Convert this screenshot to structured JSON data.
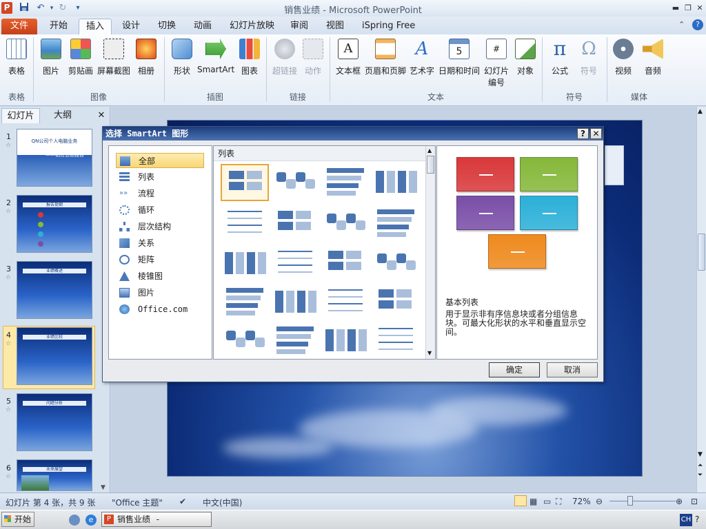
{
  "window": {
    "title": "销售业绩 - Microsoft PowerPoint",
    "app_icon_letter": "P"
  },
  "tabs": [
    {
      "label": "文件"
    },
    {
      "label": "开始"
    },
    {
      "label": "插入"
    },
    {
      "label": "设计"
    },
    {
      "label": "切换"
    },
    {
      "label": "动画"
    },
    {
      "label": "幻灯片放映"
    },
    {
      "label": "审阅"
    },
    {
      "label": "视图"
    },
    {
      "label": "iSpring Free"
    }
  ],
  "ribbon": {
    "buttons": [
      {
        "label": "表格"
      },
      {
        "label": "图片"
      },
      {
        "label": "剪贴画"
      },
      {
        "label": "屏幕截图"
      },
      {
        "label": "相册"
      },
      {
        "label": "形状"
      },
      {
        "label": "SmartArt"
      },
      {
        "label": "图表"
      },
      {
        "label": "超链接"
      },
      {
        "label": "动作"
      },
      {
        "label": "文本框"
      },
      {
        "label": "页眉和页脚"
      },
      {
        "label": "艺术字"
      },
      {
        "label": "日期和时间"
      },
      {
        "label": "幻灯片"
      },
      {
        "label": "对象"
      },
      {
        "label": "公式"
      },
      {
        "label": "符号"
      },
      {
        "label": "视频"
      },
      {
        "label": "音频"
      }
    ],
    "slide_number_second_line": "编号",
    "groups": [
      {
        "label": "表格"
      },
      {
        "label": "图像"
      },
      {
        "label": "插图"
      },
      {
        "label": "链接"
      },
      {
        "label": "文本"
      },
      {
        "label": "符号"
      },
      {
        "label": "媒体"
      }
    ]
  },
  "left_panel": {
    "tab_slides": "幻灯片",
    "tab_outline": "大纲",
    "close": "✕",
    "slides": [
      {
        "num": "1",
        "title": "QN公司个人电脑业务",
        "subtitle": "——销售业绩报告"
      },
      {
        "num": "2",
        "title": "报告提纲"
      },
      {
        "num": "3",
        "title": "业绩概述"
      },
      {
        "num": "4",
        "title": "业绩比较"
      },
      {
        "num": "5",
        "title": "问题分析"
      },
      {
        "num": "6",
        "title": "未来展望"
      }
    ]
  },
  "dialog": {
    "title": "选择 SmartArt 图形",
    "help": "?",
    "close": "✕",
    "categories": [
      {
        "label": "全部"
      },
      {
        "label": "列表"
      },
      {
        "label": "流程"
      },
      {
        "label": "循环"
      },
      {
        "label": "层次结构"
      },
      {
        "label": "关系"
      },
      {
        "label": "矩阵"
      },
      {
        "label": "棱锥图"
      },
      {
        "label": "图片"
      },
      {
        "label": "Office.com"
      }
    ],
    "gallery_header": "列表",
    "preview_title": "基本列表",
    "preview_desc": "用于显示非有序信息块或者分组信息块。可最大化形状的水平和垂直显示空间。",
    "ok": "确定",
    "cancel": "取消",
    "preview_colors": [
      "#d9383a",
      "#86b83a",
      "#7a4ea8",
      "#2cb0d8",
      "#ef8a1e"
    ]
  },
  "status": {
    "slide_info": "幻灯片 第 4 张，共 9 张",
    "theme": "\"Office 主题\"",
    "language": "中文(中国)",
    "zoom": "72%"
  },
  "taskbar": {
    "start": "开始",
    "task": "销售业绩 - Microsof...",
    "ime": "CH"
  }
}
